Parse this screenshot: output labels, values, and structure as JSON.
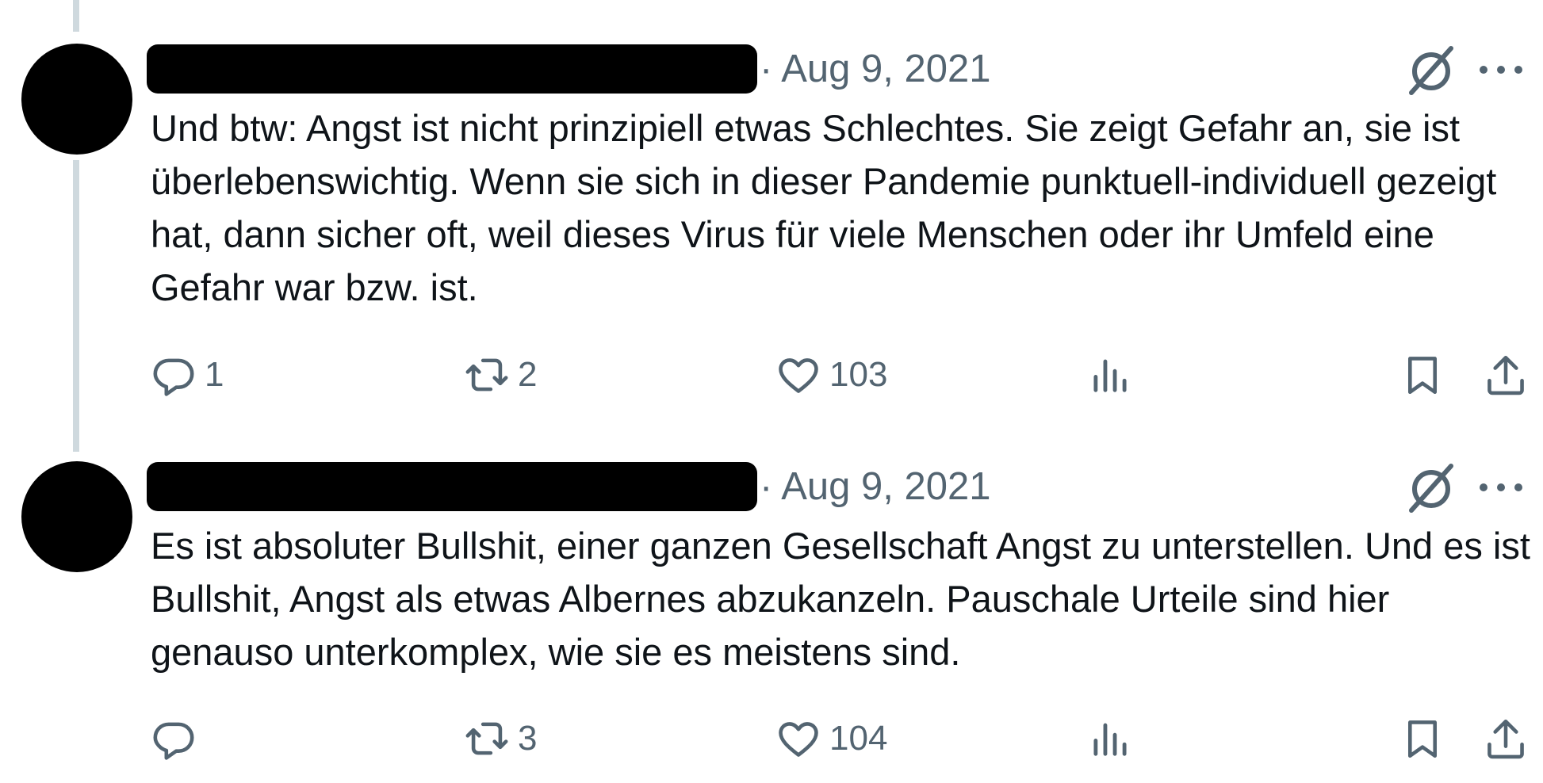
{
  "tweets": [
    {
      "timestamp": "· Aug 9, 2021",
      "text": "Und btw: Angst ist nicht prinzipiell etwas Schlechtes. Sie zeigt Gefahr an, sie ist überlebenswichtig. Wenn sie sich in dieser Pandemie punktuell-individuell gezeigt hat, dann sicher oft, weil dieses Virus für viele Menschen oder ihr Umfeld eine Gefahr war bzw. ist.",
      "replies": "1",
      "reposts": "2",
      "likes": "103"
    },
    {
      "timestamp": "· Aug 9, 2021",
      "text": "Es ist absoluter Bullshit, einer ganzen Gesellschaft Angst zu unterstellen. Und es ist Bullshit, Angst als etwas Albernes abzukanzeln. Pauschale Urteile sind hier genauso unterkomplex, wie sie es meistens sind.",
      "replies": "",
      "reposts": "3",
      "likes": "104"
    }
  ],
  "icons": [
    "grok-icon",
    "more-icon",
    "reply-icon",
    "repost-icon",
    "like-icon",
    "views-icon",
    "bookmark-icon",
    "share-icon"
  ],
  "colors": {
    "text": "#0f1419",
    "secondary": "#536471",
    "thread_line": "#cfd9de",
    "redaction": "#000000"
  }
}
